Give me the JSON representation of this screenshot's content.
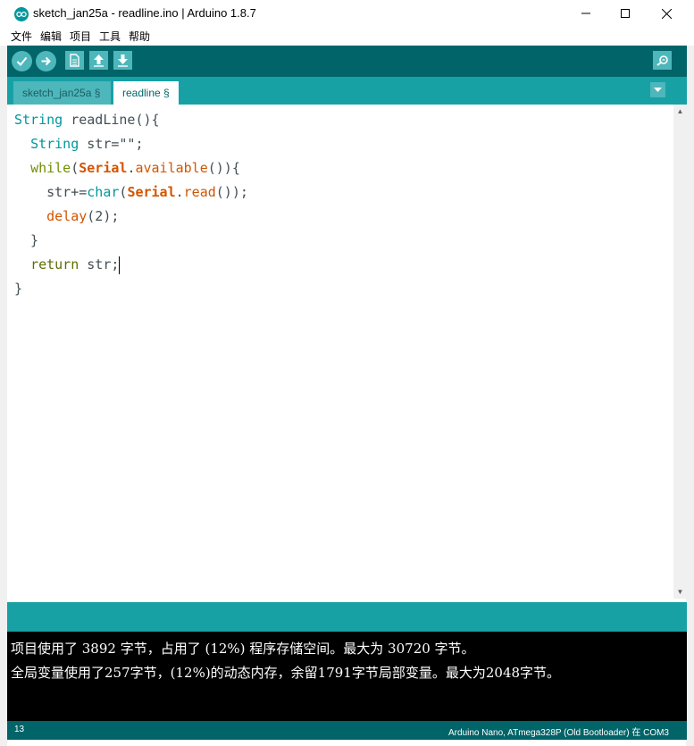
{
  "window": {
    "title": "sketch_jan25a - readline.ino | Arduino 1.8.7",
    "min_symbol": "—",
    "max_symbol": "☐",
    "close_symbol": "✕"
  },
  "menu": [
    "文件",
    "编辑",
    "项目",
    "工具",
    "帮助"
  ],
  "toolbar": {
    "verify_icon": "check-icon",
    "upload_icon": "arrow-right-icon",
    "new_icon": "new-file-icon",
    "open_icon": "arrow-up-icon",
    "save_icon": "arrow-down-icon",
    "serial_monitor_icon": "magnifier-icon"
  },
  "tabs": [
    {
      "label": "sketch_jan25a §",
      "active": false
    },
    {
      "label": "readline §",
      "active": true
    }
  ],
  "editor": {
    "lines": [
      "String readLine(){",
      "  String str=\"\";",
      "  while(Serial.available()){",
      "    str+=char(Serial.read());",
      "    delay(2);",
      "  }",
      "  return str;",
      "}"
    ]
  },
  "console": {
    "lines": [
      "项目使用了 3892 字节，占用了 (12%) 程序存储空间。最大为 30720 字节。",
      "全局变量使用了257字节，(12%)的动态内存，余留1791字节局部变量。最大为2048字节。"
    ]
  },
  "status": {
    "line_number": "13",
    "board": "Arduino Nano, ATmega328P (Old Bootloader) 在 COM3"
  },
  "colors": {
    "toolbar": "#006468",
    "tabbar": "#17a1a5",
    "button": "#4db7bb",
    "console": "#000000"
  }
}
